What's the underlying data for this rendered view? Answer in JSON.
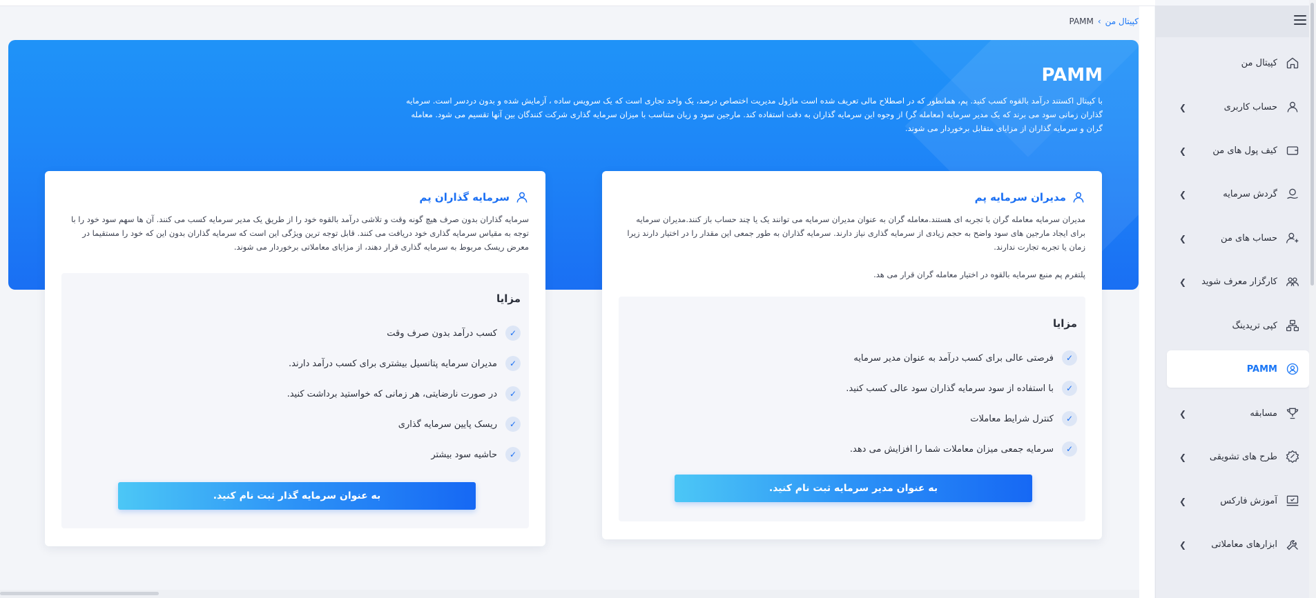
{
  "sidebar": {
    "items": [
      {
        "label": "کپیتال من",
        "icon": "home-icon",
        "chevron": false,
        "active": false
      },
      {
        "label": "حساب کاربری",
        "icon": "user-icon",
        "chevron": true,
        "active": false
      },
      {
        "label": "کیف پول های من",
        "icon": "wallet-icon",
        "chevron": true,
        "active": false
      },
      {
        "label": "گردش سرمایه",
        "icon": "money-flow-icon",
        "chevron": true,
        "active": false
      },
      {
        "label": "حساب های من",
        "icon": "accounts-icon",
        "chevron": true,
        "active": false
      },
      {
        "label": "کارگزار معرف شوید",
        "icon": "group-icon",
        "chevron": true,
        "active": false
      },
      {
        "label": "کپی تریدینگ",
        "icon": "copy-trading-icon",
        "chevron": false,
        "active": false
      },
      {
        "label": "PAMM",
        "icon": "pamm-icon",
        "chevron": false,
        "active": true
      },
      {
        "label": "مسابقه",
        "icon": "trophy-icon",
        "chevron": true,
        "active": false
      },
      {
        "label": "طرح های تشویقی",
        "icon": "badge-icon",
        "chevron": true,
        "active": false
      },
      {
        "label": "آموزش فارکس",
        "icon": "education-icon",
        "chevron": true,
        "active": false
      },
      {
        "label": "ابزارهای معاملاتی",
        "icon": "tools-icon",
        "chevron": true,
        "active": false
      }
    ]
  },
  "breadcrumb": {
    "parent": "کپیتال من",
    "current": "PAMM"
  },
  "hero": {
    "title": "PAMM",
    "text": "با کپیتال اکستند درآمد بالقوه کسب کنید. پم، همانطور که در اصطلاح مالی تعریف شده است ماژول مدیریت اختصاص درصد، یک واحد تجاری است که یک سرویس ساده ، آزمایش شده و بدون دردسر است. سرمایه گذاران زمانی سود می برند که یک مدیر سرمایه (معامله گر) از وجوه این سرمایه گذاران به دقت استفاده کند. مارجین سود و زیان متناسب با میزان سرمایه گذاری شرکت کنندگان بین آنها تقسیم می شود. معامله گران و سرمایه گذاران از مزایای متقابل برخوردار می شوند."
  },
  "managers_card": {
    "title": "مدیران سرمایه پم",
    "desc1": "مدیران سرمایه معامله گران با تجربه ای هستند.معامله گران به عنوان مدیران سرمایه می توانند یک یا چند حساب باز کنند.مدیران سرمایه برای ایجاد مارجین های سود واضح به حجم زیادی از سرمایه گذاری نیاز دارند. سرمایه گذاران به طور جمعی این مقدار را در اختیار دارند زیرا زمان یا تجربه تجارت ندارند.",
    "desc2": "پلتفرم پم منبع سرمایه بالقوه در اختیار معامله گران قرار می هد.",
    "benefits_title": "مزایا",
    "benefits": [
      "فرصتی عالی برای کسب درآمد به عنوان مدیر سرمایه",
      "با استفاده از سود سرمایه گذاران سود عالی کسب کنید.",
      "کنترل شرایط معاملات",
      "سرمایه جمعی میزان معاملات شما را افزایش می دهد."
    ],
    "cta": "به عنوان مدیر سرمایه ثبت نام کنید."
  },
  "investors_card": {
    "title": "سرمایه گذاران پم",
    "desc1": "سرمایه گذاران بدون صرف هیچ گونه وقت و تلاشی درآمد بالقوه خود را از طریق یک مدیر سرمایه کسب می کنند. آن ها سهم سود خود را با توجه به مقیاس سرمایه گذاری خود دریافت می کنند. قابل توجه ترین ویژگی این است که سرمایه گذاران بدون این که خود را مستقیما در معرض ریسک مربوط به سرمایه گذاری قرار دهند، از مزایای معاملاتی برخوردار می شوند.",
    "benefits_title": "مزایا",
    "benefits": [
      "کسب درآمد بدون صرف وقت",
      "مدیران سرمایه پتانسیل بیشتری برای کسب درآمد دارند.",
      "در صورت نارضایتی، هر زمانی که خواستید برداشت کنید.",
      "ریسک پایین سرمایه گذاری",
      "حاشیه سود بیشتر"
    ],
    "cta": "به عنوان سرمایه گذار ثبت نام کنید."
  },
  "colors": {
    "accent": "#1a76f5",
    "hero_top": "#1f93f8",
    "hero_bottom": "#1a6ff3"
  }
}
